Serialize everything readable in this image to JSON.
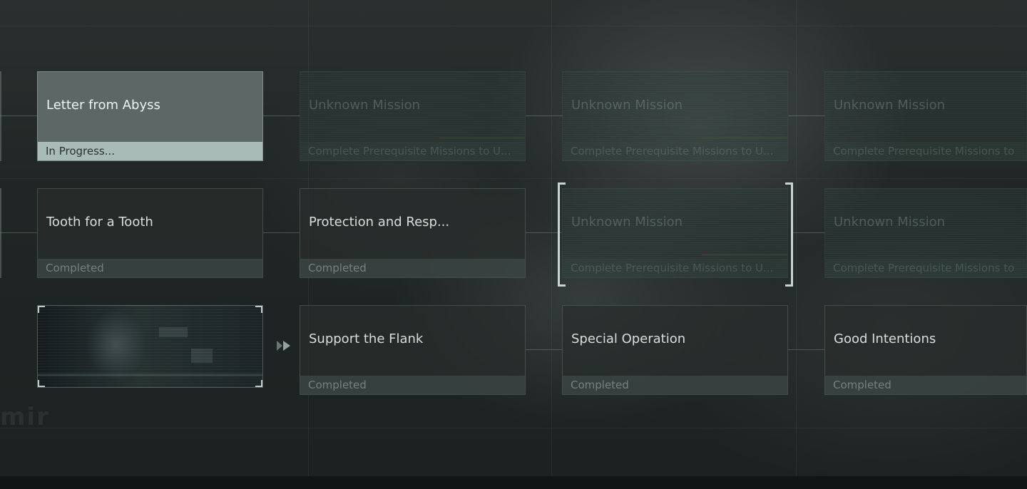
{
  "colors": {
    "background": "#1b2020",
    "card_completed": "#2e3433",
    "card_active": "#5d6866",
    "status_active": "#a9bbb7",
    "bracket": "#c8d4d1",
    "locked_glitch": "#aa3c32"
  },
  "watermark": "mir",
  "missions": {
    "letter_from_abyss": {
      "title": "Letter from Abyss",
      "status": "In Progress..."
    },
    "unknown_1": {
      "title": "Unknown Mission",
      "status": "Complete Prerequisite Missions to U..."
    },
    "unknown_2": {
      "title": "Unknown Mission",
      "status": "Complete Prerequisite Missions to U..."
    },
    "unknown_3": {
      "title": "Unknown Mission",
      "status": "Complete Prerequisite Missions to"
    },
    "tooth_for_a_tooth": {
      "title": "Tooth for a Tooth",
      "status": "Completed"
    },
    "protection": {
      "title": "Protection and Resp...",
      "status": "Completed"
    },
    "unknown_selected": {
      "title": "Unknown Mission",
      "status": "Complete Prerequisite Missions to U..."
    },
    "unknown_4": {
      "title": "Unknown Mission",
      "status": "Complete Prerequisite Missions to"
    },
    "support_the_flank": {
      "title": "Support the Flank",
      "status": "Completed"
    },
    "special_operation": {
      "title": "Special Operation",
      "status": "Completed"
    },
    "good_intentions": {
      "title": "Good Intentions",
      "status": "Completed"
    }
  },
  "icons": {
    "video_play": "play-forward-icon"
  }
}
